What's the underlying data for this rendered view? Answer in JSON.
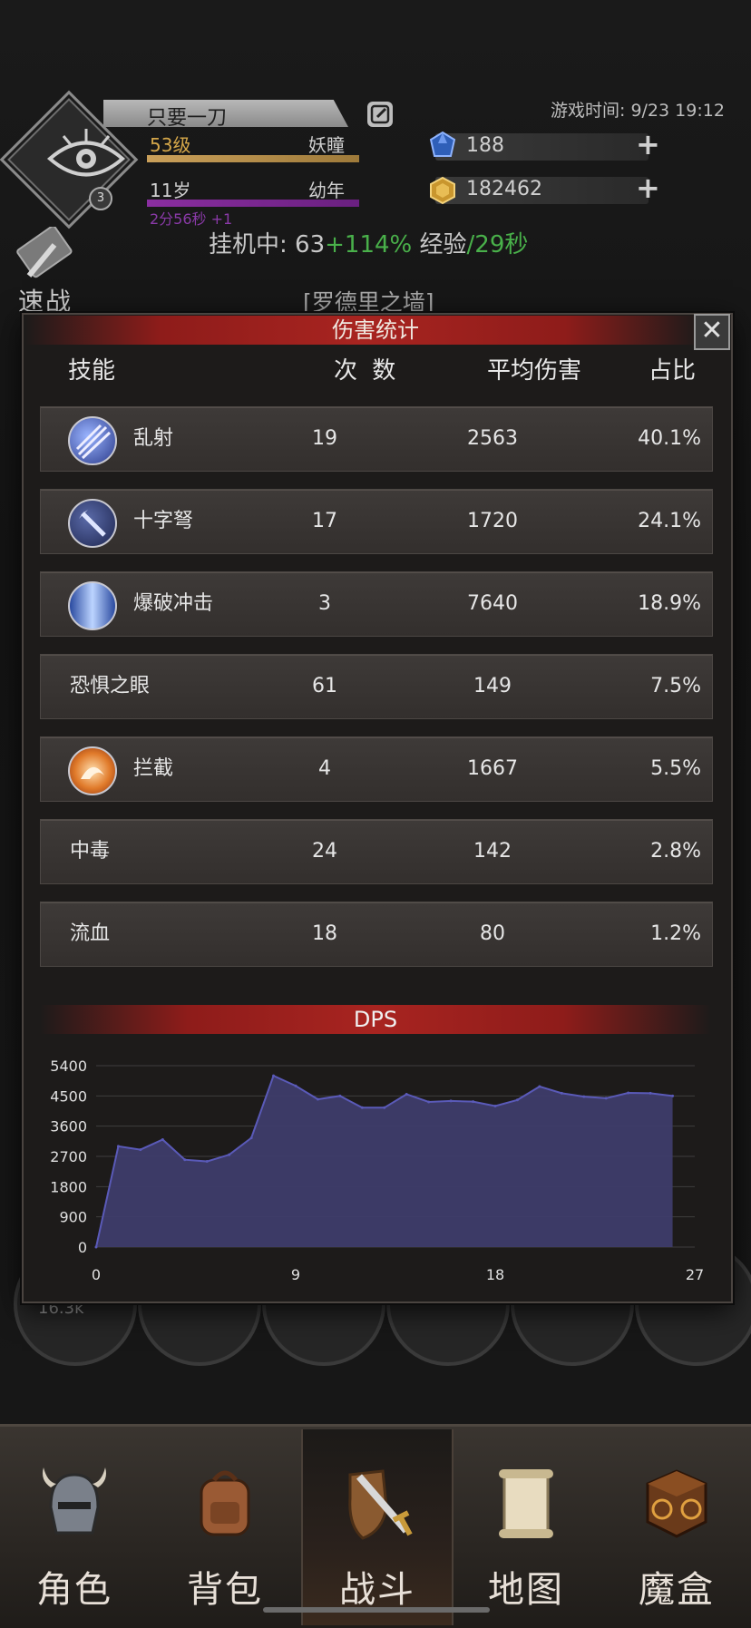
{
  "header": {
    "player_name": "只要一刀",
    "level": "53级",
    "eye_type": "妖瞳",
    "age": "11岁",
    "age_stage": "幼年",
    "timer": "2分56秒 +1",
    "emblem_badge": "3",
    "game_time_label": "游戏时间: 9/23 19:12",
    "resource_gem": "188",
    "resource_gold": "182462",
    "idle_prefix": "挂机中:",
    "idle_value": "63",
    "idle_bonus": "+114%",
    "idle_exp": "经验",
    "idle_rate": "/29秒",
    "quick_battle": "速战",
    "location": "[罗德里之墙]",
    "colors": {
      "level": "#d6a84a",
      "bonus": "#49b04a",
      "age_bar": "#8a2ea0"
    }
  },
  "modal": {
    "title": "伤害统计",
    "close_icon": "close-icon",
    "columns": {
      "skill": "技能",
      "count": "次 数",
      "avg": "平均伤害",
      "ratio": "占比"
    },
    "rows": [
      {
        "name": "乱射",
        "count": "19",
        "avg": "2563",
        "ratio": "40.1%",
        "icon": "volley-icon"
      },
      {
        "name": "十字弩",
        "count": "17",
        "avg": "1720",
        "ratio": "24.1%",
        "icon": "crossbow-icon"
      },
      {
        "name": "爆破冲击",
        "count": "3",
        "avg": "7640",
        "ratio": "18.9%",
        "icon": "blast-icon"
      },
      {
        "name": "恐惧之眼",
        "count": "61",
        "avg": "149",
        "ratio": "7.5%",
        "icon": ""
      },
      {
        "name": "拦截",
        "count": "4",
        "avg": "1667",
        "ratio": "5.5%",
        "icon": "intercept-icon"
      },
      {
        "name": "中毒",
        "count": "24",
        "avg": "142",
        "ratio": "2.8%",
        "icon": ""
      },
      {
        "name": "流血",
        "count": "18",
        "avg": "80",
        "ratio": "1.2%",
        "icon": ""
      }
    ],
    "dps_title": "DPS"
  },
  "chart_data": {
    "type": "area",
    "title": "DPS",
    "xlabel": "",
    "ylabel": "",
    "x_ticks": [
      0,
      9,
      18,
      27
    ],
    "y_ticks": [
      0,
      900,
      1800,
      2700,
      3600,
      4500,
      5400
    ],
    "xlim": [
      0,
      27
    ],
    "ylim": [
      0,
      5400
    ],
    "grid": true,
    "color": "#3e3c6a",
    "line_color": "#5a5ab8",
    "x": [
      0,
      1,
      2,
      3,
      4,
      5,
      6,
      7,
      8,
      9,
      10,
      11,
      12,
      13,
      14,
      15,
      16,
      17,
      18,
      19,
      20,
      21,
      22,
      23,
      24,
      25,
      26
    ],
    "y": [
      0,
      3000,
      2900,
      3200,
      2600,
      2550,
      2750,
      3250,
      5100,
      4800,
      4400,
      4500,
      4150,
      4150,
      4550,
      4320,
      4350,
      4330,
      4200,
      4380,
      4780,
      4580,
      4480,
      4430,
      4590,
      4580,
      4500
    ]
  },
  "left_bg_value": "16.3k",
  "nav": {
    "items": [
      {
        "label": "角色",
        "icon": "helmet-icon"
      },
      {
        "label": "背包",
        "icon": "backpack-icon"
      },
      {
        "label": "战斗",
        "icon": "sword-shield-icon"
      },
      {
        "label": "地图",
        "icon": "map-scroll-icon"
      },
      {
        "label": "魔盒",
        "icon": "magic-box-icon"
      }
    ]
  }
}
